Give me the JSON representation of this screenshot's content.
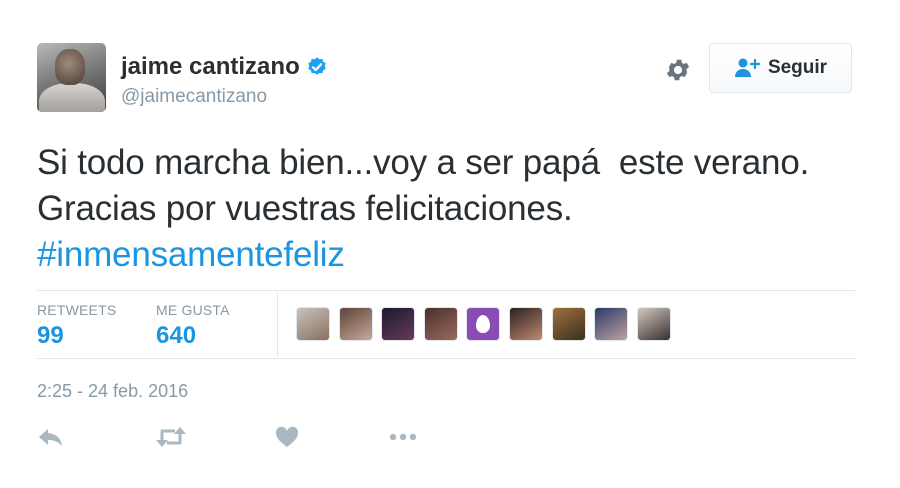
{
  "tweet": {
    "author_name": "jaime cantizano",
    "author_handle": "@jaimecantizano",
    "text_main": "Si todo marcha bien...voy a ser papá  este verano. Gracias por vuestras felicitaciones.",
    "hashtag": "#inmensamentefeliz",
    "timestamp": "2:25 - 24 feb. 2016"
  },
  "header": {
    "follow_label": "Seguir",
    "verified": true
  },
  "stats": {
    "retweets_label": "RETWEETS",
    "retweets_value": "99",
    "likes_label": "ME GUSTA",
    "likes_value": "640"
  },
  "likers": [
    {
      "colors": [
        "#c9c3bd",
        "#8a6e60"
      ]
    },
    {
      "colors": [
        "#5b4438",
        "#c9a89a"
      ]
    },
    {
      "colors": [
        "#1a1a2e",
        "#6a3a5a"
      ]
    },
    {
      "colors": [
        "#4a3030",
        "#9a6a5a"
      ]
    },
    {
      "colors": [
        "#8a4db5",
        "#8a4db5"
      ]
    },
    {
      "colors": [
        "#2a2020",
        "#c08a70"
      ]
    },
    {
      "colors": [
        "#a0703a",
        "#3a3020"
      ]
    },
    {
      "colors": [
        "#2a3a6a",
        "#c0a0a0"
      ]
    },
    {
      "colors": [
        "#d0c8c0",
        "#3a3030"
      ]
    }
  ],
  "colors": {
    "accent": "#1b95e0",
    "muted": "#8899a6",
    "text": "#292f33",
    "divider": "#e1e8ed",
    "verified_badge": "#1da1f2"
  },
  "icons": {
    "reply": "reply-icon",
    "retweet": "retweet-icon",
    "like": "heart-icon",
    "more": "more-icon",
    "settings": "gear-icon",
    "follow": "add-user-icon"
  }
}
